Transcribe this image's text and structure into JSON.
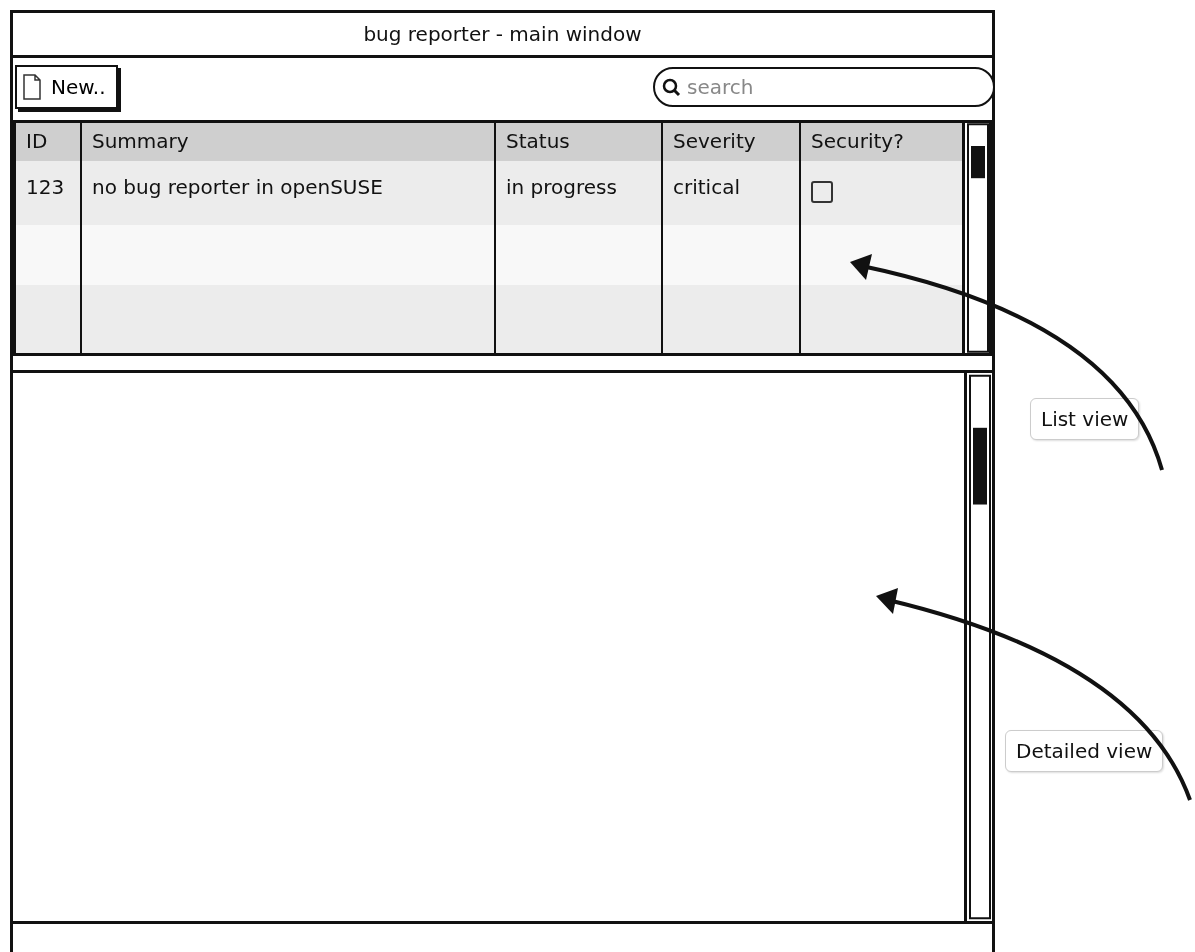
{
  "window": {
    "title": "bug reporter - main window"
  },
  "toolbar": {
    "new_button": "New..",
    "search": {
      "placeholder": "search"
    }
  },
  "table": {
    "columns": [
      "ID",
      "Summary",
      "Status",
      "Severity",
      "Security?"
    ],
    "rows": [
      {
        "id": "123",
        "summary": "no bug reporter in openSUSE",
        "status": "in progress",
        "severity": "critical",
        "security": false
      }
    ]
  },
  "annotations": [
    {
      "kind": "list",
      "label": "List view"
    },
    {
      "kind": "detail",
      "label": "Detailed view"
    }
  ]
}
